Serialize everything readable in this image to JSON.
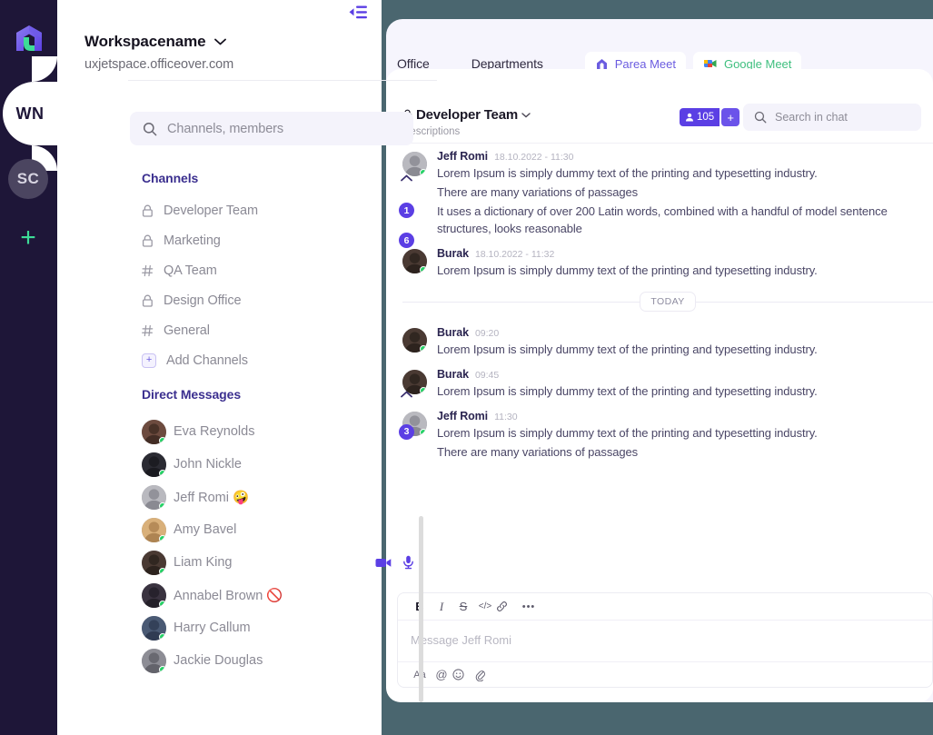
{
  "rail": {
    "logo_icon": "parea-logo-icon",
    "active_workspace_initials": "WN",
    "other_workspace_initials": "SC",
    "add_workspace_label": "+"
  },
  "sidebar": {
    "collapse_icon": "collapse-sidebar-icon",
    "workspace": {
      "name": "Workspacename",
      "url": "uxjetspace.officeover.com",
      "chevron_icon": "chevron-down-icon"
    },
    "search": {
      "placeholder": "Channels, members",
      "icon": "search-icon"
    },
    "channels_section": {
      "title": "Channels",
      "collapse_icon": "chevron-up-icon",
      "items": [
        {
          "name": "Developer Team",
          "icon": "lock-icon",
          "badge": "1"
        },
        {
          "name": "Marketing",
          "icon": "lock-icon",
          "badge": "6"
        },
        {
          "name": "QA Team",
          "icon": "hash-icon",
          "badge": ""
        },
        {
          "name": "Design Office",
          "icon": "lock-icon",
          "badge": ""
        },
        {
          "name": "General",
          "icon": "hash-icon",
          "badge": ""
        }
      ],
      "add_label": "Add Channels",
      "add_icon": "plus-square-icon"
    },
    "dm_section": {
      "title": "Direct Messages",
      "collapse_icon": "chevron-up-icon",
      "items": [
        {
          "name": "Eva Reynolds",
          "badge": "3",
          "status": "online",
          "emoji": "",
          "icons": []
        },
        {
          "name": "John Nickle",
          "badge": "",
          "status": "online",
          "emoji": "",
          "icons": []
        },
        {
          "name": "Jeff Romi",
          "badge": "",
          "status": "online",
          "emoji": "🤪",
          "icons": []
        },
        {
          "name": "Amy Bavel",
          "badge": "",
          "status": "online",
          "emoji": "",
          "icons": []
        },
        {
          "name": "Liam King",
          "badge": "",
          "status": "online",
          "emoji": "",
          "icons": [
            "video-camera-icon",
            "microphone-icon"
          ]
        },
        {
          "name": "Annabel Brown",
          "badge": "",
          "status": "online",
          "emoji": "🚫",
          "icons": []
        },
        {
          "name": "Harry Callum",
          "badge": "",
          "status": "online",
          "emoji": "",
          "icons": []
        },
        {
          "name": "Jackie Douglas",
          "badge": "",
          "status": "online",
          "emoji": "",
          "icons": []
        }
      ]
    }
  },
  "main": {
    "topnav": [
      {
        "label": "Office"
      },
      {
        "label": "Departments"
      }
    ],
    "meet_buttons": [
      {
        "label": "Parea Meet",
        "icon": "parea-meet-icon",
        "color": "#6b5ce0"
      },
      {
        "label": "Google Meet",
        "icon": "google-meet-icon",
        "color": "#3fbf7f"
      }
    ],
    "chat_header": {
      "channel_name": "Developer Team",
      "lock_icon": "lock-icon",
      "chevron_icon": "chevron-down-icon",
      "description": "Descriptions",
      "member_count": "105",
      "member_icon": "person-icon",
      "add_member_label": "+",
      "search_placeholder": "Search in chat",
      "search_icon": "search-icon"
    },
    "messages": [
      {
        "author": "Jeff Romi",
        "time": "18.10.2022 - 11:30",
        "lines": [
          "Lorem Ipsum is simply dummy text of the printing and typesetting industry.",
          "There are many variations of passages",
          "It uses a dictionary of over 200 Latin words, combined with a handful of model sentence structures, looks reasonable"
        ]
      },
      {
        "author": "Burak",
        "time": "18.10.2022 - 11:32",
        "lines": [
          "Lorem Ipsum is simply dummy text of the printing and typesetting industry."
        ]
      }
    ],
    "divider_label": "TODAY",
    "messages_today": [
      {
        "author": "Burak",
        "time": "09:20",
        "lines": [
          "Lorem Ipsum is simply dummy text of the printing and typesetting industry."
        ]
      },
      {
        "author": "Burak",
        "time": "09:45",
        "lines": [
          "Lorem Ipsum is simply dummy text of the printing and typesetting industry."
        ]
      },
      {
        "author": "Jeff Romi",
        "time": "11:30",
        "lines": [
          "Lorem Ipsum is simply dummy text of the printing and typesetting industry.",
          "There are many variations of passages"
        ]
      }
    ],
    "composer": {
      "placeholder": "Message Jeff Romi",
      "format_tools": [
        {
          "label": "B",
          "icon": "bold-icon"
        },
        {
          "label": "I",
          "icon": "italic-icon"
        },
        {
          "label": "S",
          "icon": "strikethrough-icon"
        },
        {
          "label": "</>",
          "icon": "code-icon"
        },
        {
          "label": "🔗",
          "icon": "link-icon"
        },
        {
          "label": "•••",
          "icon": "more-icon"
        }
      ],
      "action_tools": [
        {
          "label": "Aa",
          "icon": "text-format-icon"
        },
        {
          "label": "@",
          "icon": "mention-icon"
        },
        {
          "label": "☺",
          "icon": "emoji-icon"
        },
        {
          "label": "📎",
          "icon": "attachment-icon"
        }
      ]
    }
  },
  "colors": {
    "rail_bg": "#1e1638",
    "accent": "#5b3fe4",
    "page_bg": "#4a666f",
    "panel_bg": "#f6f5fd",
    "online": "#25d366"
  }
}
